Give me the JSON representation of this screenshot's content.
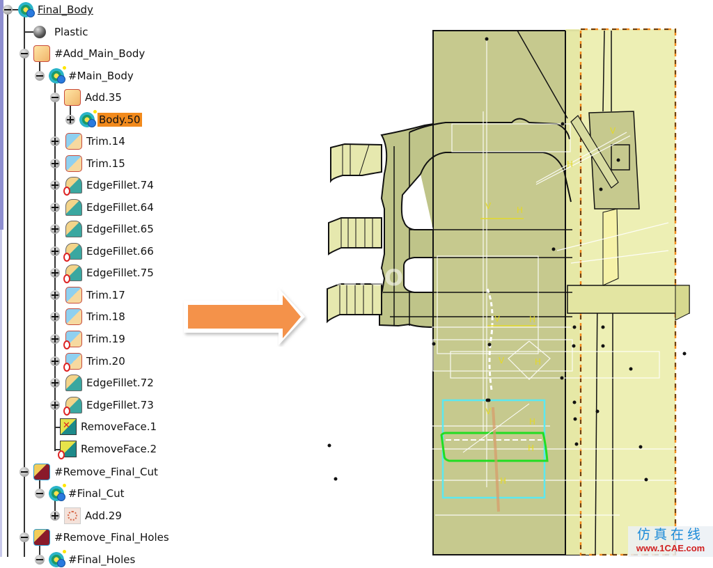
{
  "tree": {
    "nodes": [
      {
        "label": "Final_Body",
        "icon": "body-gear-icon",
        "expander": "minus"
      },
      {
        "label": "Plastic",
        "icon": "material-sphere-icon",
        "expander": "none"
      },
      {
        "label": "#Add_Main_Body",
        "icon": "add-operation-icon",
        "expander": "minus"
      },
      {
        "label": "#Main_Body",
        "icon": "body-gear-icon",
        "expander": "minus"
      },
      {
        "label": "Add.35",
        "icon": "add-operation-icon",
        "expander": "minus"
      },
      {
        "label": "Body.50",
        "icon": "body-gear-icon",
        "expander": "plus",
        "selected": true
      },
      {
        "label": "Trim.14",
        "icon": "trim-icon",
        "expander": "plus"
      },
      {
        "label": "Trim.15",
        "icon": "trim-icon",
        "expander": "plus"
      },
      {
        "label": "EdgeFillet.74",
        "icon": "edge-fillet-icon",
        "expander": "plus"
      },
      {
        "label": "EdgeFillet.64",
        "icon": "edge-fillet-icon",
        "expander": "plus"
      },
      {
        "label": "EdgeFillet.65",
        "icon": "edge-fillet-icon",
        "expander": "plus"
      },
      {
        "label": "EdgeFillet.66",
        "icon": "edge-fillet-icon",
        "expander": "plus"
      },
      {
        "label": "EdgeFillet.75",
        "icon": "edge-fillet-icon",
        "expander": "plus"
      },
      {
        "label": "Trim.17",
        "icon": "trim-icon",
        "expander": "plus"
      },
      {
        "label": "Trim.18",
        "icon": "trim-icon",
        "expander": "plus"
      },
      {
        "label": "Trim.19",
        "icon": "trim-icon",
        "expander": "plus"
      },
      {
        "label": "Trim.20",
        "icon": "trim-icon",
        "expander": "plus"
      },
      {
        "label": "EdgeFillet.72",
        "icon": "edge-fillet-icon",
        "expander": "plus"
      },
      {
        "label": "EdgeFillet.73",
        "icon": "edge-fillet-icon",
        "expander": "plus"
      },
      {
        "label": "RemoveFace.1",
        "icon": "remove-face-icon",
        "expander": "none"
      },
      {
        "label": "RemoveFace.2",
        "icon": "remove-face-icon",
        "expander": "none"
      },
      {
        "label": "#Remove_Final_Cut",
        "icon": "remove-operation-icon",
        "expander": "minus"
      },
      {
        "label": "#Final_Cut",
        "icon": "body-gear-icon",
        "expander": "minus"
      },
      {
        "label": "Add.29",
        "icon": "add-operation-icon",
        "expander": "plus"
      },
      {
        "label": "#Remove_Final_Holes",
        "icon": "remove-operation-icon",
        "expander": "minus"
      },
      {
        "label": "#Final_Holes",
        "icon": "body-gear-icon",
        "expander": "minus"
      }
    ]
  },
  "arrow": {
    "color": "#f4924a",
    "direction": "right"
  },
  "viewport": {
    "part_color": "#c6c98e",
    "transparent_part_color": "#e8eaa8",
    "highlight_color": "#f28a1c",
    "watermark": "1CAE.COM"
  },
  "logo": {
    "chinese": "仿真在线",
    "url": "www.1CAE.com"
  }
}
